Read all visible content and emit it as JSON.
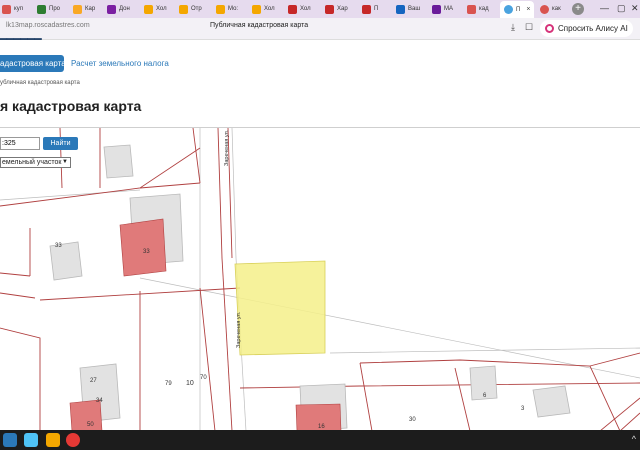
{
  "browser": {
    "tabs": [
      {
        "label": "куп",
        "color": "#d9534f"
      },
      {
        "label": "Про",
        "color": "#2e7d32"
      },
      {
        "label": "Кар",
        "color": "#f9a825"
      },
      {
        "label": "Дон",
        "color": "#7b1fa2"
      },
      {
        "label": "Хол",
        "color": "#f4a700"
      },
      {
        "label": "Отр",
        "color": "#f4a700"
      },
      {
        "label": "Мо:",
        "color": "#f4a700"
      },
      {
        "label": "Хол",
        "color": "#f4a700"
      },
      {
        "label": "Хол",
        "color": "#c62828"
      },
      {
        "label": "Хар",
        "color": "#c62828"
      },
      {
        "label": "П",
        "color": "#c62828"
      },
      {
        "label": "Ваш",
        "color": "#1565c0"
      },
      {
        "label": "МА",
        "color": "#6a1b9a"
      },
      {
        "label": "кад",
        "color": "#d9534f"
      }
    ],
    "active_tab": {
      "label": "П",
      "close": "×"
    },
    "extra_tab": {
      "label": "как",
      "color": "#d9534f"
    },
    "new_tab": "+",
    "url": "lk13map.roscadastres.com",
    "page_title": "Публичная кадастровая карта",
    "ask_alice": "Спросить Алису AI"
  },
  "page": {
    "nav_active": "адастровая карта",
    "nav_link": "Расчет земельного налога",
    "breadcrumb": "убличная кадастровая карта",
    "heading": "я кадастровая карта"
  },
  "map": {
    "search_value": ":325",
    "search_button": "Найти",
    "type_select": "емельный участок",
    "street_labels": [
      "Зареченая ул.",
      "Зареченая ул."
    ],
    "parcel_labels": [
      "33",
      "33",
      "27",
      "34",
      "79",
      "10",
      "70",
      "30",
      "6",
      "3",
      "50",
      "16"
    ]
  },
  "colors": {
    "parcel_highlight": "#f5f08a",
    "building_red": "#e07a7a",
    "building_grey": "#e2e2e2",
    "boundary": "#b04040",
    "accent": "#2b79b9"
  }
}
